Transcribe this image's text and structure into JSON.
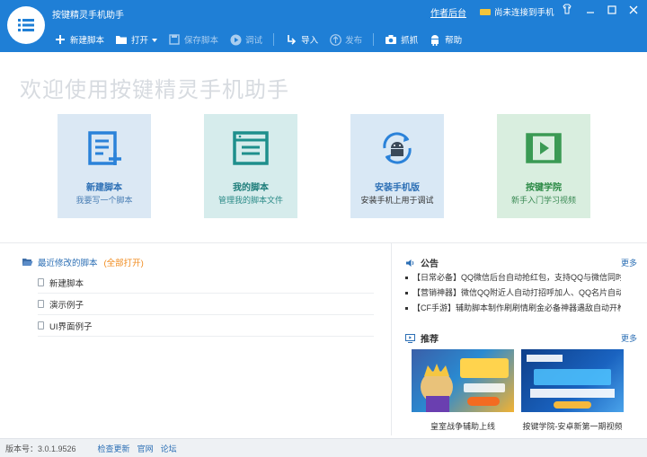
{
  "app": {
    "title": "按键精灵手机助手",
    "author_link": "作者后台",
    "phone_status": "尚未连接到手机"
  },
  "toolbar": {
    "new_script": "新建脚本",
    "open": "打开",
    "save_script": "保存脚本",
    "debug": "调试",
    "import": "导入",
    "publish": "发布",
    "capture": "抓抓",
    "help": "帮助"
  },
  "welcome": "欢迎使用按键精灵手机助手",
  "cards": [
    {
      "title": "新建脚本",
      "subtitle": "我要写一个脚本",
      "icon": "new-script-icon"
    },
    {
      "title": "我的脚本",
      "subtitle": "管理我的脚本文件",
      "icon": "my-scripts-icon"
    },
    {
      "title": "安装手机版",
      "subtitle": "安装手机上用于调试",
      "icon": "android-sync-icon"
    },
    {
      "title": "按键学院",
      "subtitle": "新手入门学习视频",
      "icon": "video-icon"
    }
  ],
  "recent": {
    "title": "最近修改的脚本",
    "open_all": "(全部打开)",
    "items": [
      "新建脚本",
      "演示例子",
      "UI界面例子"
    ]
  },
  "notice": {
    "title": "公告",
    "more": "更多",
    "items": [
      "【日常必备】QQ微信后台自动抢红包，支持QQ与微信同时抢!",
      "【营销神器】微信QQ附近人自动打招呼加人、QQ名片自动点赞",
      "【CF手游】辅助脚本制作刷刷情刷金必备神器遇敌自动开枪"
    ]
  },
  "recommend": {
    "title": "推荐",
    "more": "更多",
    "items": [
      {
        "caption": "皇室战争辅助上线"
      },
      {
        "caption": "按键学院-安卓新第一期视频"
      }
    ]
  },
  "status": {
    "version": "版本号：3.0.1.9526",
    "links": [
      "检查更新",
      "官网",
      "论坛"
    ]
  },
  "colors": {
    "header": "#1f7fd6",
    "accent_blue": "#2c6fb5",
    "orange": "#f08a1c"
  }
}
